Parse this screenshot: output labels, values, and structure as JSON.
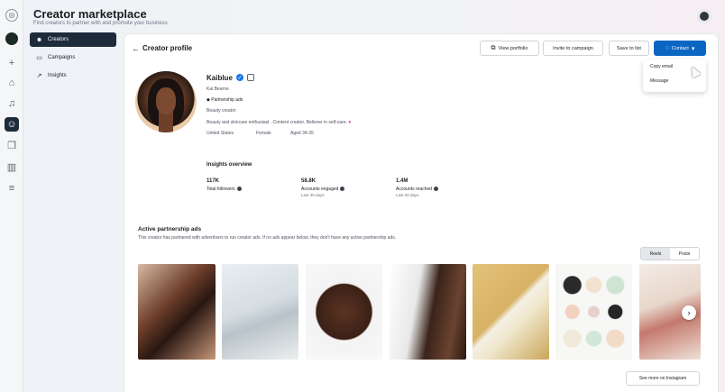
{
  "header": {
    "title": "Creator marketplace",
    "subtitle": "Find creators to partner with and promote your business"
  },
  "rail_icons": [
    "meta-icon",
    "avatar-icon",
    "plus-icon",
    "home-icon",
    "bell-icon",
    "creators-icon",
    "pages-icon",
    "chart-icon",
    "menu-icon"
  ],
  "nav": {
    "items": [
      {
        "label": "Creators",
        "icon": "creators-icon",
        "active": true
      },
      {
        "label": "Campaigns",
        "icon": "folder-icon",
        "active": false
      },
      {
        "label": "Insights",
        "icon": "trend-icon",
        "active": false
      }
    ]
  },
  "page": {
    "back_icon": "←",
    "title": "Creator profile"
  },
  "actions": {
    "view_portfolio": "View portfolio",
    "invite": "Invite to campaign",
    "save": "Save to list",
    "contact": "Contact"
  },
  "contact_menu": {
    "items": [
      "Copy email",
      "Message"
    ]
  },
  "profile": {
    "name": "Kaiblue",
    "handle": "Kai Bearne",
    "partnership": "Partnership ads",
    "category": "Beauty creator",
    "bio": "Beauty and skincare enthusiast . Content creator. Believer in self-care.",
    "bio_emoji": "♥",
    "tags": [
      "United States",
      "Female",
      "Aged 34-35"
    ]
  },
  "insights": {
    "title": "Insights overview",
    "metrics": [
      {
        "value": "117K",
        "label": "Total followers",
        "sub": ""
      },
      {
        "value": "58.8K",
        "label": "Accounts engaged",
        "sub": "Last 30 days"
      },
      {
        "value": "1.4M",
        "label": "Accounts reached",
        "sub": "Last 30 days"
      }
    ]
  },
  "partnership": {
    "title": "Active partnership ads",
    "subtitle": "This creator has partnered with advertisers to run creator ads. If no ads appear below, they don't have any active partnership ads.",
    "tabs": [
      "Reels",
      "Posts"
    ],
    "see_more": "See more on Instagram"
  },
  "colors": {
    "accent": "#0a66c2",
    "active_nav": "#1d2b3a",
    "verified": "#1877f2"
  }
}
